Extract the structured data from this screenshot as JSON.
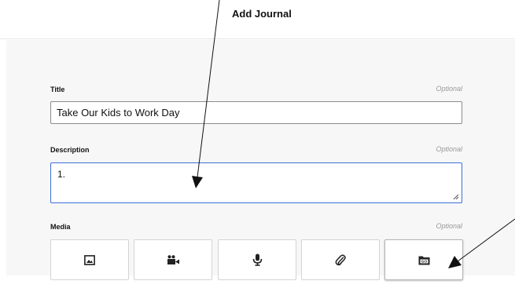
{
  "header": {
    "title": "Add Journal"
  },
  "form": {
    "title_field": {
      "label": "Title",
      "optional": "Optional",
      "value": "Take Our Kids to Work Day"
    },
    "description_field": {
      "label": "Description",
      "optional": "Optional",
      "value": "1."
    },
    "media_field": {
      "label": "Media",
      "optional": "Optional"
    }
  },
  "media_buttons": [
    {
      "icon": "image-icon"
    },
    {
      "icon": "video-camera-icon"
    },
    {
      "icon": "microphone-icon"
    },
    {
      "icon": "paperclip-icon"
    },
    {
      "icon": "go-folder-icon"
    }
  ],
  "colors": {
    "focus_border": "#3a6fd8",
    "optional_text": "#9a9a9a",
    "panel_bg": "#f7f7f7"
  }
}
